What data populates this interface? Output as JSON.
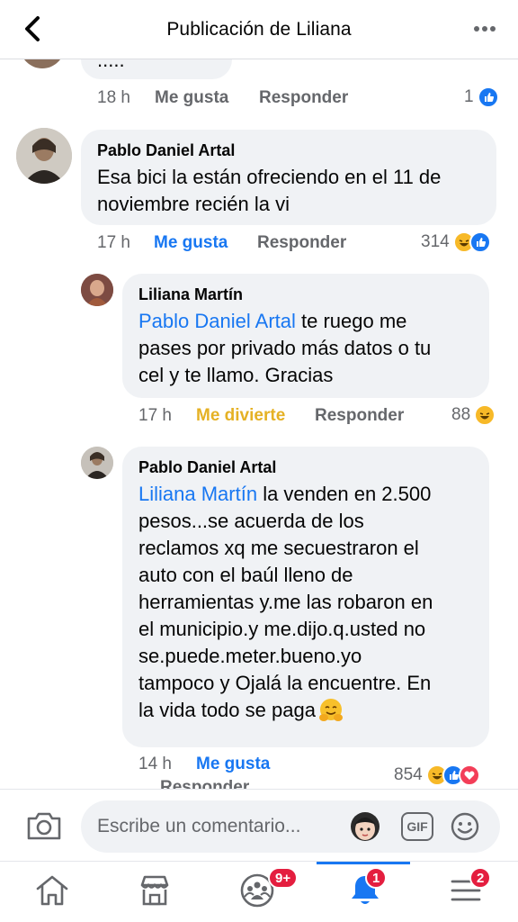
{
  "header": {
    "title": "Publicación de Liliana"
  },
  "top_partial": {
    "text": ".....",
    "time": "18 h",
    "like_label": "Me gusta",
    "reply_label": "Responder",
    "reaction_count": "1"
  },
  "comments": [
    {
      "author": "Pablo Daniel Artal",
      "lines": [
        "Esa bici la están ofreciendo en el 11 de",
        "noviembre recién la vi"
      ],
      "time": "17 h",
      "like_label": "Me gusta",
      "reply_label": "Responder",
      "reaction_count": "314"
    },
    {
      "author": "Liliana Martín",
      "mention": "Pablo Daniel Artal",
      "lines": [
        " te ruego me",
        "pases por privado más datos o tu",
        "cel y te llamo. Gracias"
      ],
      "time": "17 h",
      "like_label": "Me divierte",
      "reply_label": "Responder",
      "reaction_count": "88"
    },
    {
      "author": "Pablo Daniel Artal",
      "mention": "Liliana Martín",
      "lines": [
        " la venden en 2.500",
        "pesos...se acuerda de los",
        "reclamos xq me secuestraron el",
        "auto con el baúl lleno de",
        "herramientas y.me las robaron en",
        "el municipio.y me.dijo.q.usted no",
        "se.puede.meter.bueno.yo",
        "tampoco y Ojalá la encuentre. En",
        "la vida todo se paga"
      ],
      "time": "14 h",
      "like_label": "Me gusta",
      "reply_label": "Responder",
      "reaction_count": "854"
    }
  ],
  "composer": {
    "placeholder": "Escribe un comentario...",
    "gif_label": "GIF"
  },
  "tabbar": {
    "groups_badge": "9+",
    "notifications_badge": "1",
    "menu_badge": "2"
  },
  "colors": {
    "accent": "#1877f2",
    "bubble": "#f0f2f5",
    "haha": "#e5b124",
    "badge": "#e41e3f"
  }
}
